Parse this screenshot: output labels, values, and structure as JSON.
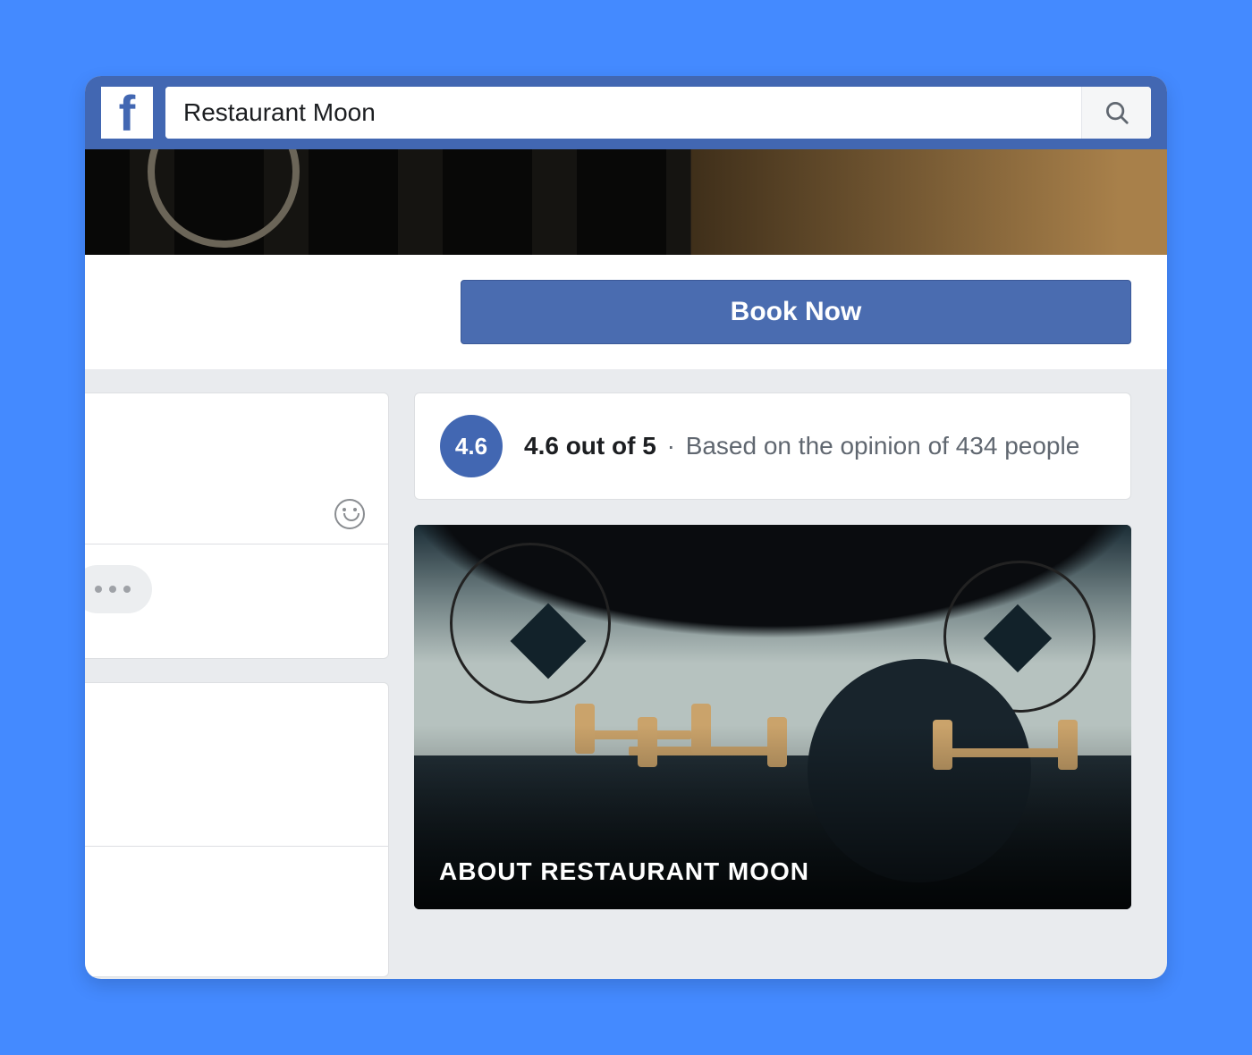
{
  "search": {
    "value": "Restaurant Moon"
  },
  "cta": {
    "book_label": "Book Now"
  },
  "rating": {
    "badge": "4.6",
    "bold_text": "4.6 out of 5",
    "separator": "·",
    "grey_text": "Based on the opinion of 434 people"
  },
  "about": {
    "title": "ABOUT RESTAURANT MOON"
  }
}
